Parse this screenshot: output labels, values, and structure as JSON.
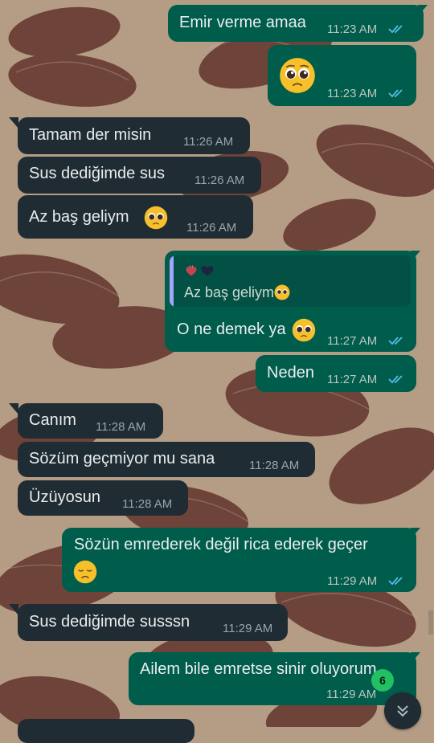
{
  "messages": [
    {
      "text": "Emir verme amaa",
      "time": "11:23 AM"
    },
    {
      "time": "11:23 AM",
      "emoji": "pleading-face"
    },
    {
      "text": "Tamam der misin",
      "time": "11:26 AM"
    },
    {
      "text": "Sus dediğimde sus",
      "time": "11:26 AM"
    },
    {
      "text": "Az baş geliym",
      "time": "11:26 AM",
      "emoji": "pleading-face"
    },
    {
      "quote_text": "Az baş geliym",
      "text": "O ne demek ya",
      "time": "11:27 AM",
      "emoji": "pleading-face",
      "quote_icons": [
        "anatomical-heart-icon",
        "black-heart-icon"
      ]
    },
    {
      "text": "Neden",
      "time": "11:27 AM"
    },
    {
      "text": "Canım",
      "time": "11:28 AM"
    },
    {
      "text": "Sözüm geçmiyor mu sana",
      "time": "11:28 AM"
    },
    {
      "text": "Üzüyosun",
      "time": "11:28 AM"
    },
    {
      "text": "Sözün emrederek değil rica ederek geçer",
      "time": "11:29 AM",
      "emoji": "disappointed-face"
    },
    {
      "text": "Sus dediğimde susssn",
      "time": "11:29 AM"
    },
    {
      "text": "Ailem bile emretse sinir oluyorum",
      "time": "11:29 AM"
    }
  ],
  "unread_badge": "6",
  "colors": {
    "outgoing_bubble": "#005c4b",
    "incoming_bubble": "#202c33",
    "read_ticks": "#53bdeb",
    "badge": "#21c063"
  },
  "icons": {
    "read_receipt": "double-check-icon",
    "scroll_down": "chevron-double-down-icon"
  }
}
